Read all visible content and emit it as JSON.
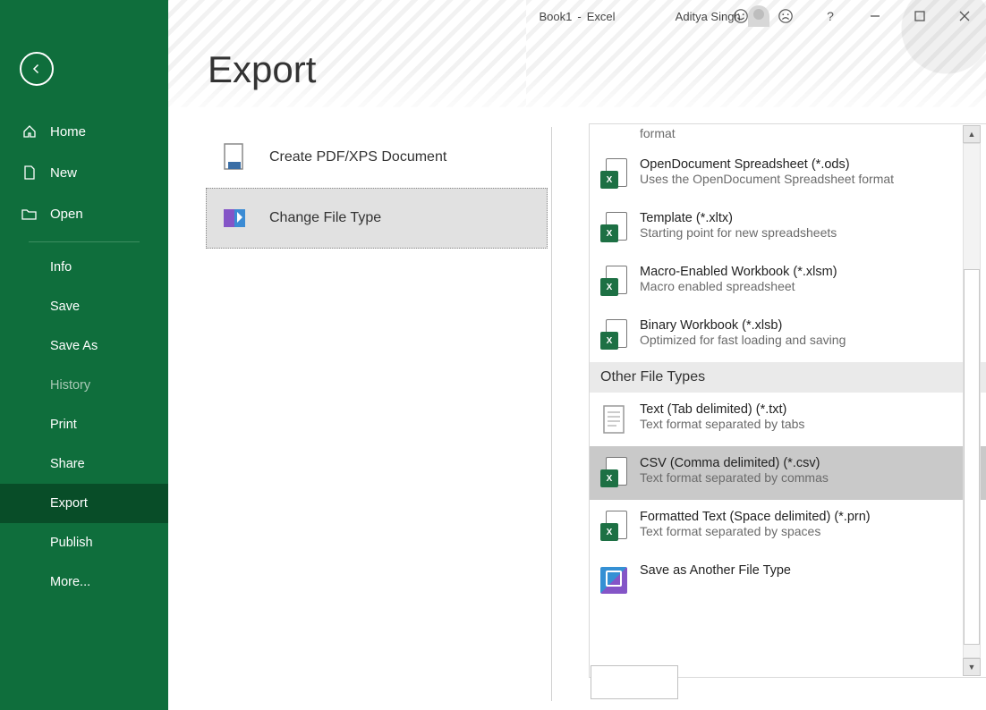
{
  "titlebar": {
    "doc": "Book1",
    "sep": "-",
    "app": "Excel",
    "user": "Aditya Singh"
  },
  "sidebar": {
    "home": "Home",
    "new": "New",
    "open": "Open",
    "info": "Info",
    "save": "Save",
    "saveas": "Save As",
    "history": "History",
    "print": "Print",
    "share": "Share",
    "export": "Export",
    "publish": "Publish",
    "more": "More..."
  },
  "page_title": "Export",
  "export_opts": {
    "pdf": "Create PDF/XPS Document",
    "change": "Change File Type"
  },
  "filetypes": {
    "trailing_format": "format",
    "ods_t": "OpenDocument Spreadsheet (*.ods)",
    "ods_d": "Uses the OpenDocument Spreadsheet format",
    "xltx_t": "Template (*.xltx)",
    "xltx_d": "Starting point for new spreadsheets",
    "xlsm_t": "Macro-Enabled Workbook (*.xlsm)",
    "xlsm_d": "Macro enabled spreadsheet",
    "xlsb_t": "Binary Workbook (*.xlsb)",
    "xlsb_d": "Optimized for fast loading and saving",
    "other_header": "Other File Types",
    "txt_t": "Text (Tab delimited) (*.txt)",
    "txt_d": "Text format separated by tabs",
    "csv_t": "CSV (Comma delimited) (*.csv)",
    "csv_d": "Text format separated by commas",
    "prn_t": "Formatted Text (Space delimited) (*.prn)",
    "prn_d": "Text format separated by spaces",
    "saf_t": "Save as Another File Type"
  }
}
